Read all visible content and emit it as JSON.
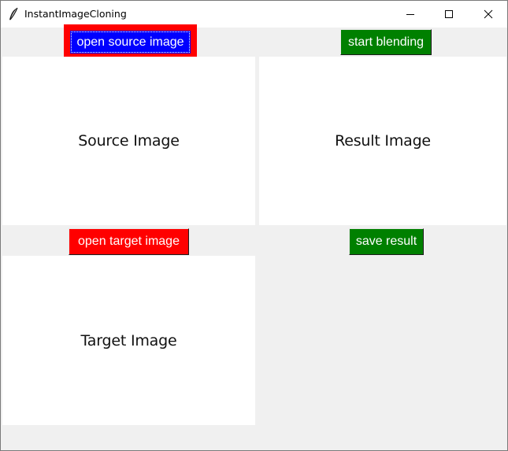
{
  "window": {
    "title": "InstantImageCloning",
    "controls": {
      "minimize_icon": "minimize-icon",
      "maximize_icon": "maximize-icon",
      "close_icon": "close-icon"
    }
  },
  "buttons": {
    "open_source": "open source image",
    "start_blending": "start blending",
    "open_target": "open target image",
    "save_result": "save result"
  },
  "panels": {
    "source": "Source Image",
    "result": "Result Image",
    "target": "Target Image"
  },
  "colors": {
    "open_source_bg": "#0000ff",
    "open_source_highlight": "#ff0000",
    "start_blending_bg": "#008000",
    "open_target_bg": "#ff0000",
    "save_result_bg": "#008000",
    "window_bg": "#f0f0f0"
  }
}
